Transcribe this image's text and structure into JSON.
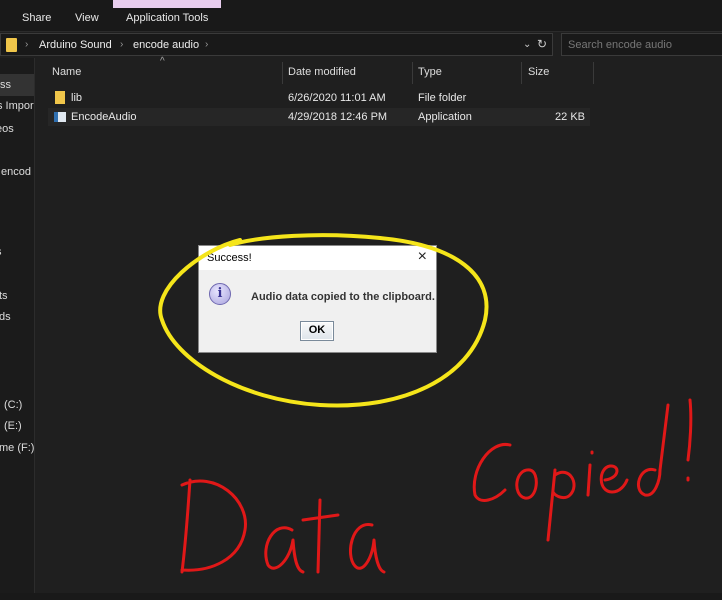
{
  "ribbon": {
    "tabs": [
      "Share",
      "View",
      "Application Tools"
    ],
    "context_color": "#e8cdee"
  },
  "address": {
    "crumbs": [
      "Arduino Sound",
      "encode audio"
    ],
    "search_placeholder": "Search encode audio"
  },
  "sidebar": {
    "items": [
      "ss",
      "s Impor",
      "eos",
      "encod",
      "s",
      "ts",
      "ds",
      "(C:)",
      "(E:)",
      "me (F:)"
    ]
  },
  "columns": {
    "name": "Name",
    "date": "Date modified",
    "type": "Type",
    "size": "Size"
  },
  "files": [
    {
      "name": "lib",
      "date": "6/26/2020 11:01 AM",
      "type": "File folder",
      "size": "",
      "icon": "folder-icon"
    },
    {
      "name": "EncodeAudio",
      "date": "4/29/2018 12:46 PM",
      "type": "Application",
      "size": "22 KB",
      "icon": "application-icon"
    }
  ],
  "dialog": {
    "title": "Success!",
    "message": "Audio data copied to the clipboard.",
    "ok": "OK",
    "icon": "info-icon"
  },
  "annotations": {
    "left": "Data",
    "right": "Copied!",
    "circle_color": "#f5e51a",
    "text_color": "#e01818"
  }
}
